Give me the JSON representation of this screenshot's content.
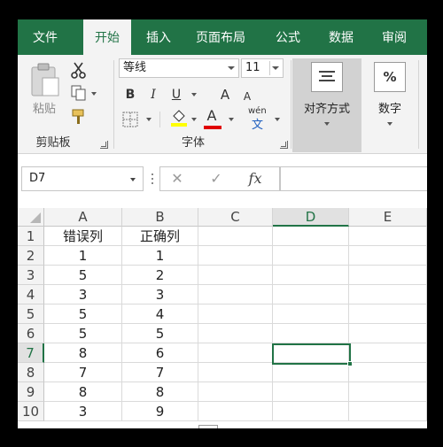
{
  "tabs": [
    {
      "label": "文件",
      "active": false
    },
    {
      "label": "开始",
      "active": true
    },
    {
      "label": "插入",
      "active": false
    },
    {
      "label": "页面布局",
      "active": false
    },
    {
      "label": "公式",
      "active": false
    },
    {
      "label": "数据",
      "active": false
    },
    {
      "label": "审阅",
      "active": false
    }
  ],
  "ribbon": {
    "clipboard": {
      "paste_label": "粘贴",
      "group_label": "剪贴板"
    },
    "font": {
      "font_name": "等线",
      "font_size": "11",
      "bold": "B",
      "italic": "I",
      "underline": "U",
      "grow": "A",
      "shrink": "A",
      "font_color": "A",
      "phonetic_top": "wén",
      "phonetic_bottom": "文",
      "group_label": "字体"
    },
    "alignment": {
      "label": "对齐方式"
    },
    "number": {
      "icon": "%",
      "label": "数字"
    }
  },
  "formula_bar": {
    "name_box": "D7",
    "cancel": "✕",
    "enter": "✓",
    "fx": "fx",
    "formula": ""
  },
  "grid": {
    "columns": [
      "A",
      "B",
      "C",
      "D",
      "E"
    ],
    "selected_column": "D",
    "selected_row": 7,
    "rows": [
      {
        "num": "1",
        "cells": [
          "错误列",
          "正确列",
          "",
          "",
          ""
        ]
      },
      {
        "num": "2",
        "cells": [
          "1",
          "1",
          "",
          "",
          ""
        ]
      },
      {
        "num": "3",
        "cells": [
          "5",
          "2",
          "",
          "",
          ""
        ]
      },
      {
        "num": "4",
        "cells": [
          "3",
          "3",
          "",
          "",
          ""
        ]
      },
      {
        "num": "5",
        "cells": [
          "5",
          "4",
          "",
          "",
          ""
        ]
      },
      {
        "num": "6",
        "cells": [
          "5",
          "5",
          "",
          "",
          ""
        ]
      },
      {
        "num": "7",
        "cells": [
          "8",
          "6",
          "",
          "",
          ""
        ]
      },
      {
        "num": "8",
        "cells": [
          "7",
          "7",
          "",
          "",
          ""
        ]
      },
      {
        "num": "9",
        "cells": [
          "8",
          "8",
          "",
          "",
          ""
        ]
      },
      {
        "num": "10",
        "cells": [
          "3",
          "9",
          "",
          "",
          ""
        ]
      }
    ]
  },
  "colors": {
    "accent": "#217346",
    "tab_bar": "#217346",
    "font_color_bar": "#e00000",
    "fill_color_bar": "#ffff00"
  }
}
